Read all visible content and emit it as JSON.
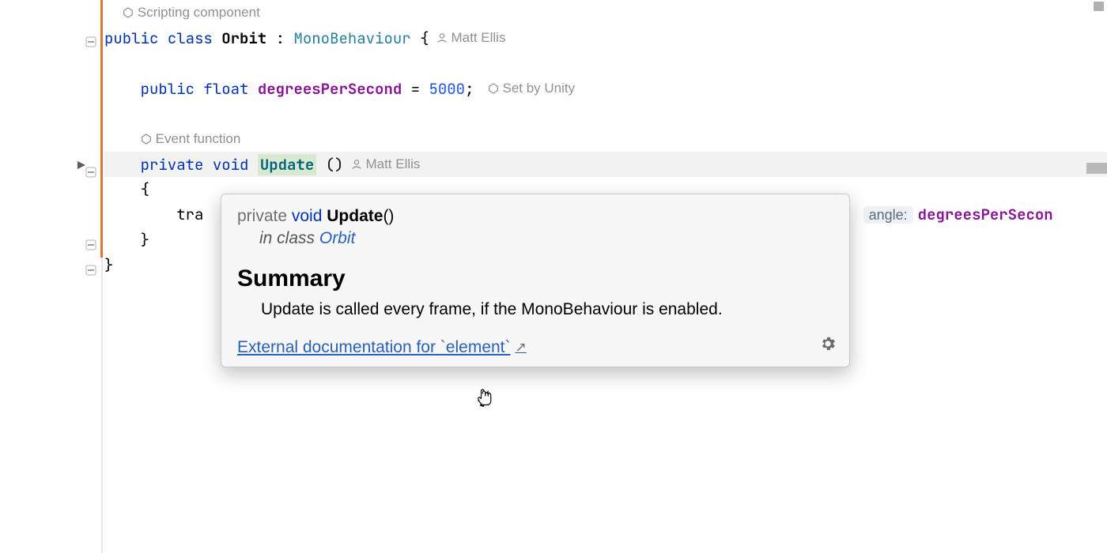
{
  "annotations": {
    "scripting_component": "Scripting component",
    "set_by_unity": "Set by Unity",
    "event_function": "Event function",
    "author_name": "Matt Ellis"
  },
  "code": {
    "kw_public": "public",
    "kw_class": "class",
    "kw_private": "private",
    "kw_void": "void",
    "kw_float": "float",
    "class_name": "Orbit",
    "base_class": "MonoBehaviour",
    "field_name": "degreesPerSecond",
    "field_value": "5000",
    "method_name": "Update",
    "partial_call": "tra",
    "param_hint_label": "angle:",
    "param_value": "degreesPerSecon",
    "comma": ",",
    "open_brace": "{",
    "close_brace": "}",
    "parens": "()",
    "lparen": "(",
    "rparen": ")",
    "colon": ":",
    "equals": "=",
    "semicolon": ";"
  },
  "popup": {
    "sig_private": "private",
    "sig_void": "void",
    "sig_method": "Update",
    "sig_parens": "()",
    "in_class_prefix": "in class ",
    "in_class_name": "Orbit",
    "summary_heading": "Summary",
    "summary_text": "Update is called every frame, if the MonoBehaviour is enabled.",
    "external_link": "External documentation for `element`"
  }
}
